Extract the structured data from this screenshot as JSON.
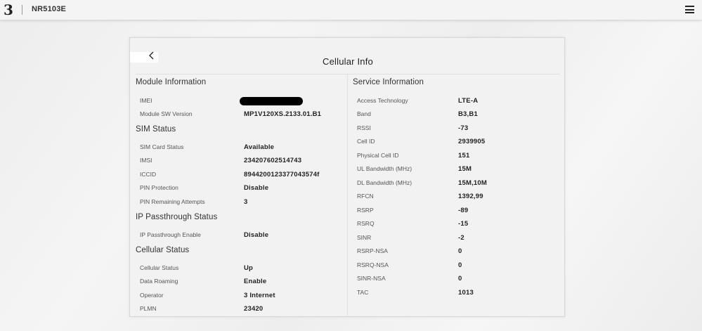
{
  "header": {
    "logo_glyph": "3",
    "model": "NR5103E"
  },
  "page": {
    "title": "Cellular Info"
  },
  "module": {
    "heading": "Module Information",
    "rows": [
      {
        "label": "IMEI",
        "value": ""
      },
      {
        "label": "Module SW Version",
        "value": "MP1V120XS.2133.01.B1"
      }
    ]
  },
  "sim": {
    "heading": "SIM Status",
    "rows": [
      {
        "label": "SIM Card Status",
        "value": "Available"
      },
      {
        "label": "IMSI",
        "value": "234207602514743"
      },
      {
        "label": "ICCID",
        "value": "8944200123377043574f"
      },
      {
        "label": "PIN Protection",
        "value": "Disable"
      },
      {
        "label": "PIN Remaining Attempts",
        "value": "3"
      }
    ]
  },
  "ip": {
    "heading": "IP Passthrough Status",
    "rows": [
      {
        "label": "IP Passthrough Enable",
        "value": "Disable"
      }
    ]
  },
  "cellular": {
    "heading": "Cellular Status",
    "rows": [
      {
        "label": "Cellular Status",
        "value": "Up"
      },
      {
        "label": "Data Roaming",
        "value": "Enable"
      },
      {
        "label": "Operator",
        "value": "3 Internet"
      },
      {
        "label": "PLMN",
        "value": "23420"
      }
    ]
  },
  "service": {
    "heading": "Service Information",
    "rows": [
      {
        "label": "Access Technology",
        "value": "LTE-A"
      },
      {
        "label": "Band",
        "value": "B3,B1"
      },
      {
        "label": "RSSI",
        "value": "-73"
      },
      {
        "label": "Cell ID",
        "value": "2939905"
      },
      {
        "label": "Physical Cell ID",
        "value": "151"
      },
      {
        "label": "UL Bandwidth (MHz)",
        "value": "15M"
      },
      {
        "label": "DL Bandwidth (MHz)",
        "value": "15M,10M"
      },
      {
        "label": "RFCN",
        "value": "1392,99"
      },
      {
        "label": "RSRP",
        "value": "-89"
      },
      {
        "label": "RSRQ",
        "value": "-15"
      },
      {
        "label": "SINR",
        "value": "-2"
      },
      {
        "label": "RSRP-NSA",
        "value": "0"
      },
      {
        "label": "RSRQ-NSA",
        "value": "0"
      },
      {
        "label": "SINR-NSA",
        "value": "0"
      },
      {
        "label": "TAC",
        "value": "1013"
      }
    ]
  },
  "icons": {
    "logo": "three-logo-icon",
    "menu": "hamburger-menu-icon",
    "back": "chevron-left-icon"
  }
}
